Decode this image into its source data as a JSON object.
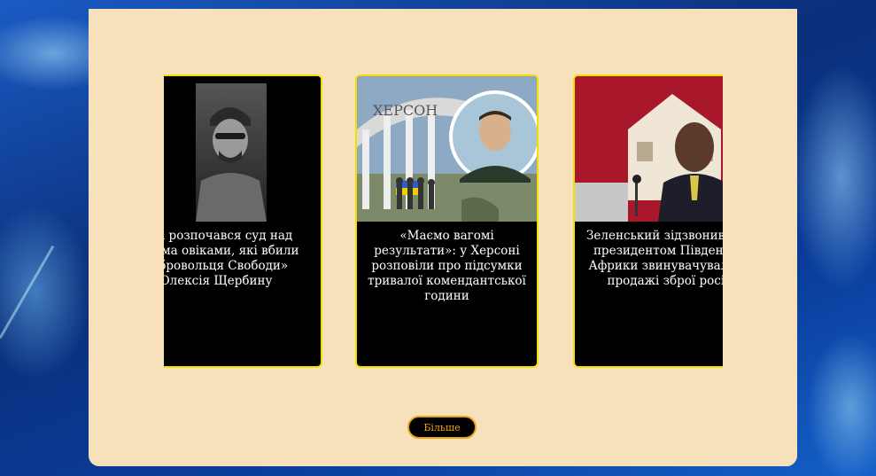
{
  "news": {
    "cards": [
      {
        "title": "иєві розпочався суд над трьома овіками, які вбили добровольця Свободи» Олексія Щербину",
        "image": "portrait-soldier-photo"
      },
      {
        "title": "«Маємо вагомі результати»: у Херсоні розповіли про підсумки тривалої комендантської години",
        "image": "kherson-arch-photo",
        "image_text": "ХЕРСОН"
      },
      {
        "title": "Зеленський зідзвонився з президентом Південної Африки звинувачували у продажі зброї росії",
        "image": "president-speech-photo"
      }
    ],
    "more_label": "Більше"
  },
  "colors": {
    "panel": "#f6e1bb",
    "card_border": "#f0e000",
    "button_border": "#e8a317"
  }
}
